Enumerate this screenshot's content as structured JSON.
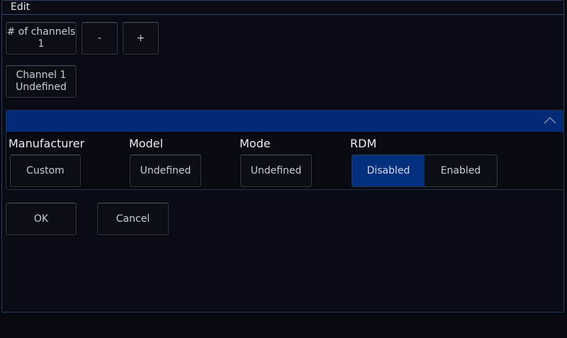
{
  "dialog": {
    "title": "Edit"
  },
  "channels": {
    "label_line1": "# of channels",
    "label_line2": "1",
    "decrement_label": "-",
    "increment_label": "+"
  },
  "channel_button": {
    "line1": "Channel 1",
    "line2": "Undefined"
  },
  "properties": {
    "manufacturer": {
      "label": "Manufacturer",
      "value": "Custom"
    },
    "model": {
      "label": "Model",
      "value": "Undefined"
    },
    "mode": {
      "label": "Mode",
      "value": "Undefined"
    },
    "rdm": {
      "label": "RDM",
      "options": [
        "Disabled",
        "Enabled"
      ],
      "selected": "Disabled"
    }
  },
  "actions": {
    "ok_label": "OK",
    "cancel_label": "Cancel"
  },
  "colors": {
    "panel_header": "#022a78",
    "selected_segment": "#02307f",
    "background": "#080a12"
  },
  "icons": {
    "panel_collapse": "chevron-up-icon"
  }
}
